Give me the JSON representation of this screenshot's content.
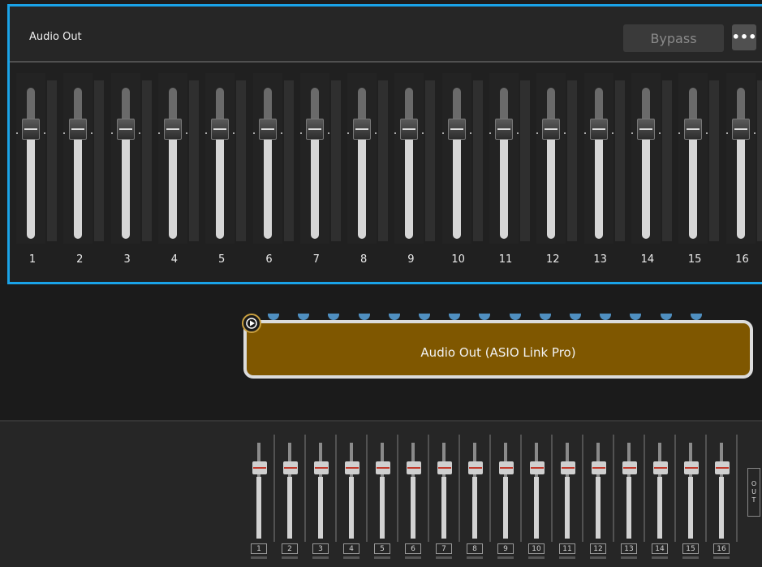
{
  "panel": {
    "title": "Audio Out",
    "bypass_label": "Bypass",
    "more_label": "•••",
    "channels": [
      "1",
      "2",
      "3",
      "4",
      "5",
      "6",
      "7",
      "8",
      "9",
      "10",
      "11",
      "12",
      "13",
      "14",
      "15",
      "16"
    ]
  },
  "node": {
    "label": "Audio Out (ASIO Link Pro)",
    "connector_icon": "play-connector-icon",
    "pin_count": 15
  },
  "mixer": {
    "channels": [
      "1",
      "2",
      "3",
      "4",
      "5",
      "6",
      "7",
      "8",
      "9",
      "10",
      "11",
      "12",
      "13",
      "14",
      "15",
      "16"
    ],
    "out_label": [
      "O",
      "U",
      "T"
    ]
  },
  "colors": {
    "accent": "#1aa3e8",
    "node_fill": "#7f5700",
    "node_border": "#dcdcdc",
    "pin": "#4f8fc0",
    "connector": "#c9a040"
  }
}
